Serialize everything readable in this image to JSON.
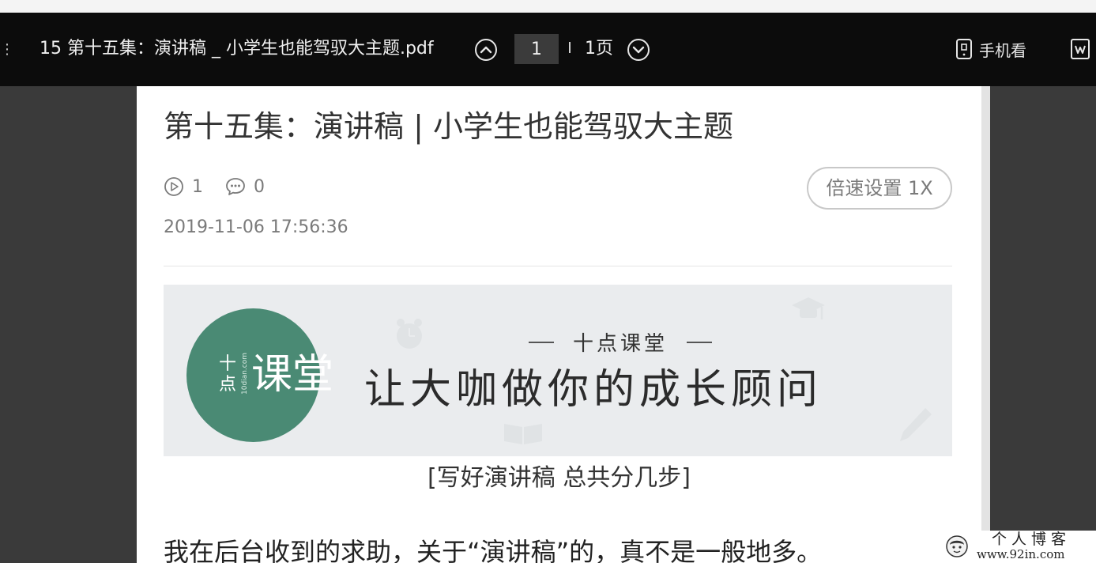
{
  "toolbar": {
    "doc_title": "15 第十五集：演讲稿 _ 小学生也能驾驭大主题.pdf",
    "current_page": "1",
    "page_total": "1页",
    "mobile_view_label": "手机看"
  },
  "article": {
    "title": "第十五集：演讲稿 | 小学生也能驾驭大主题",
    "play_count": "1",
    "comment_count": "0",
    "speed_label": "倍速设置 1X",
    "timestamp": "2019-11-06 17:56:36",
    "banner": {
      "logo_small": "十点",
      "logo_tiny": "10dian.com",
      "logo_big": "课堂",
      "subtitle": "十点课堂",
      "headline": "让大咖做你的成长顾问"
    },
    "caption": "[写好演讲稿 总共分几步]",
    "body_line": "我在后台收到的求助，关于“演讲稿”的，真不是一般地多。"
  },
  "watermark": {
    "line1": "个人博客",
    "line2": "www.92in.com"
  },
  "colors": {
    "toolbar_bg": "#0c0c0c",
    "viewer_bg": "#3a3a3a",
    "logo_green": "#4a8a74",
    "banner_bg": "#eaecee"
  }
}
